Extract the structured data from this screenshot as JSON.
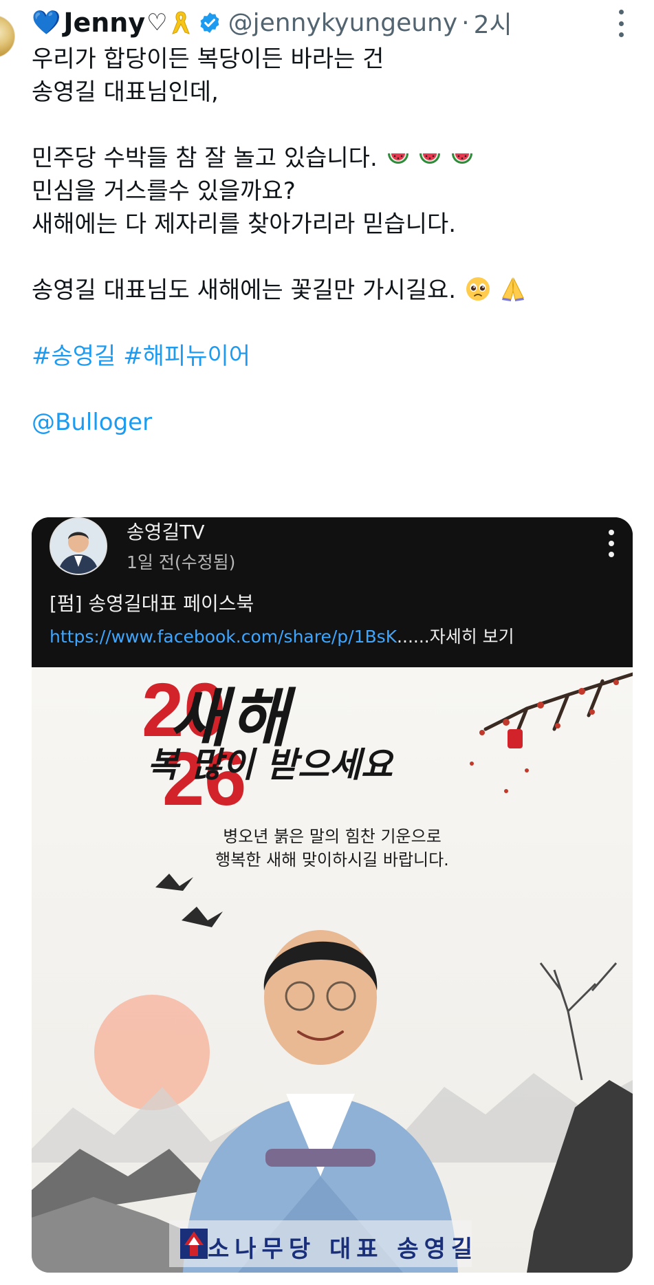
{
  "tweet": {
    "display_name": "Jenny",
    "handle": "@jennykyungeuny",
    "separator": "·",
    "time": "2시",
    "lines": [
      "우리가 합당이든 복당이든 바라는 건",
      "송영길 대표님인데,",
      "",
      "민주당 수박들 참 잘 놀고 있습니다.",
      "민심을 거스를수 있을까요?",
      "새해에는 다 제자리를 찾아가리라 믿습니다.",
      "",
      "송영길 대표님도 새해에는 꽃길만 가시길요."
    ],
    "hashtags": [
      "#송영길",
      "#해피뉴이어"
    ],
    "mention": "@Bulloger",
    "icons": {
      "heart": "blue-heart-icon",
      "white_heart": "white-heart-icon",
      "ribbon": "yellow-ribbon-icon",
      "verified": "verified-badge-icon",
      "watermelon": "watermelon-emoji",
      "pleading": "pleading-face-emoji",
      "pray": "folded-hands-emoji"
    },
    "colors": {
      "link": "#1d9bf0",
      "muted": "#536471",
      "verified": "#1d9bf0"
    }
  },
  "card": {
    "channel_name": "송영길TV",
    "post_time": "1일 전(수정됨)",
    "title": "[펌] 송영길대표 페이스북",
    "url": "https://www.facebook.com/share/p/1BsK",
    "more_label": "......자세히 보기",
    "image": {
      "year_top": "20",
      "year_bottom": "26",
      "greeting_line1": "새해",
      "greeting_line2": "복 많이 받으세요",
      "sub_line1": "병오년 붉은 말의 힘찬 기운으로",
      "sub_line2": "행복한 새해 맞이하시길 바랍니다.",
      "banner": "소나무당 대표 송영길"
    }
  }
}
